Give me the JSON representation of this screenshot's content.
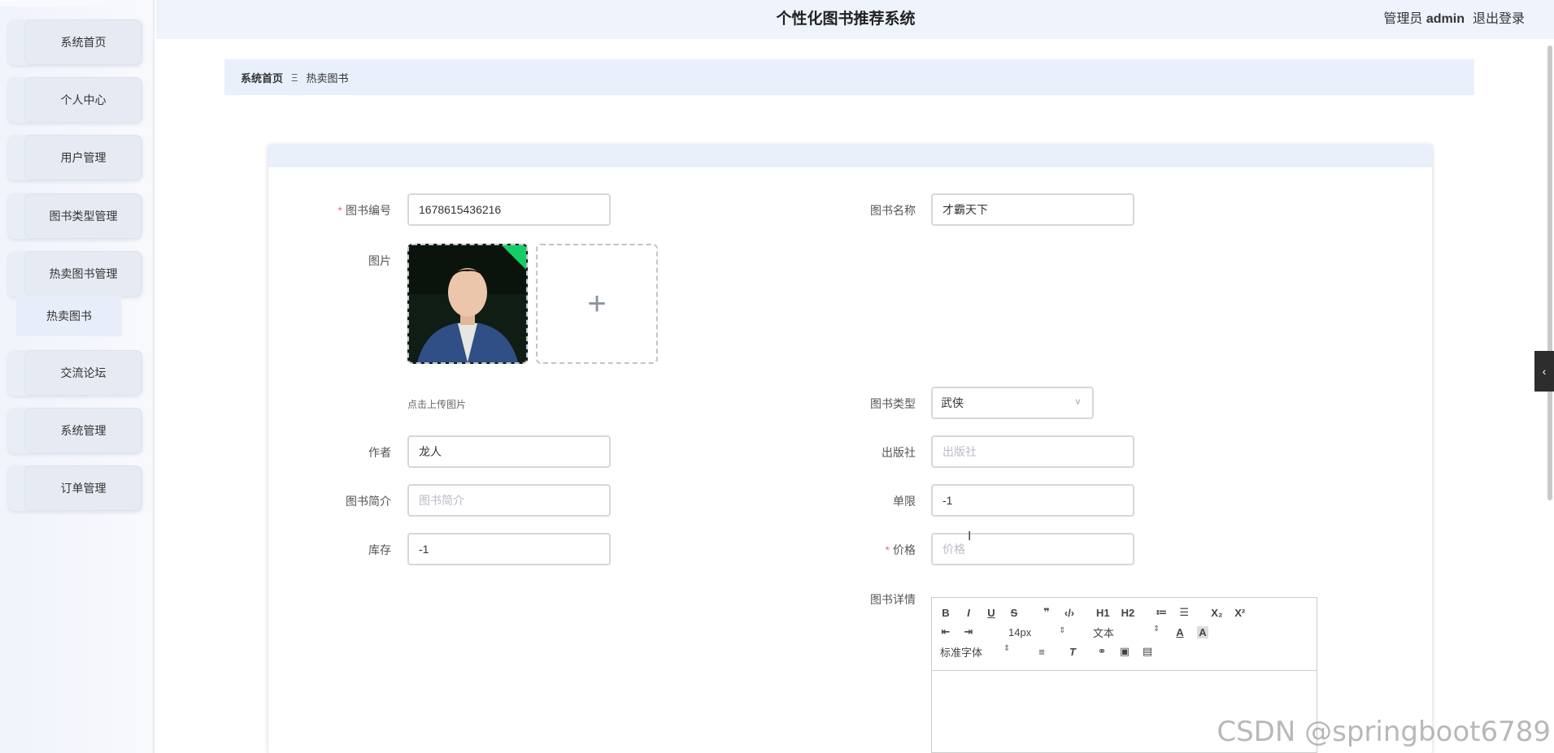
{
  "header": {
    "title": "个性化图书推荐系统",
    "role": "管理员",
    "username": "admin",
    "logout": "退出登录"
  },
  "sidebar": {
    "items": [
      {
        "label": "系统首页"
      },
      {
        "label": "个人中心"
      },
      {
        "label": "用户管理"
      },
      {
        "label": "图书类型管理"
      },
      {
        "label": "热卖图书管理"
      },
      {
        "label": "交流论坛"
      },
      {
        "label": "系统管理"
      },
      {
        "label": "订单管理"
      }
    ],
    "submenu": {
      "label": "热卖图书"
    }
  },
  "breadcrumb": {
    "home": "系统首页",
    "separator": "Ξ",
    "current": "热卖图书"
  },
  "form": {
    "book_number": {
      "label": "图书编号",
      "value": "1678615436216"
    },
    "book_name": {
      "label": "图书名称",
      "value": "才霸天下"
    },
    "image": {
      "label": "图片",
      "hint": "点击上传图片",
      "add": "+"
    },
    "book_type": {
      "label": "图书类型",
      "value": "武侠"
    },
    "author": {
      "label": "作者",
      "value": "龙人"
    },
    "publisher": {
      "label": "出版社",
      "placeholder": "出版社"
    },
    "intro": {
      "label": "图书简介",
      "placeholder": "图书简介"
    },
    "limit": {
      "label": "单限",
      "value": "-1"
    },
    "stock": {
      "label": "库存",
      "value": "-1"
    },
    "price": {
      "label": "价格",
      "placeholder": "价格"
    },
    "detail": {
      "label": "图书详情"
    }
  },
  "editor": {
    "row1": [
      "B",
      "I",
      "U",
      "S",
      "❞",
      "‹/›",
      "H1",
      "H2",
      "≔",
      "☰",
      "X₂",
      "X²"
    ],
    "font_size": "14px",
    "header_select": "文本",
    "font_family": "标准字体"
  },
  "watermark": "CSDN @springboot6789",
  "colors": {
    "accent": "#eaf0fb",
    "required": "#f56c6c",
    "upload_check": "#13ce66"
  }
}
